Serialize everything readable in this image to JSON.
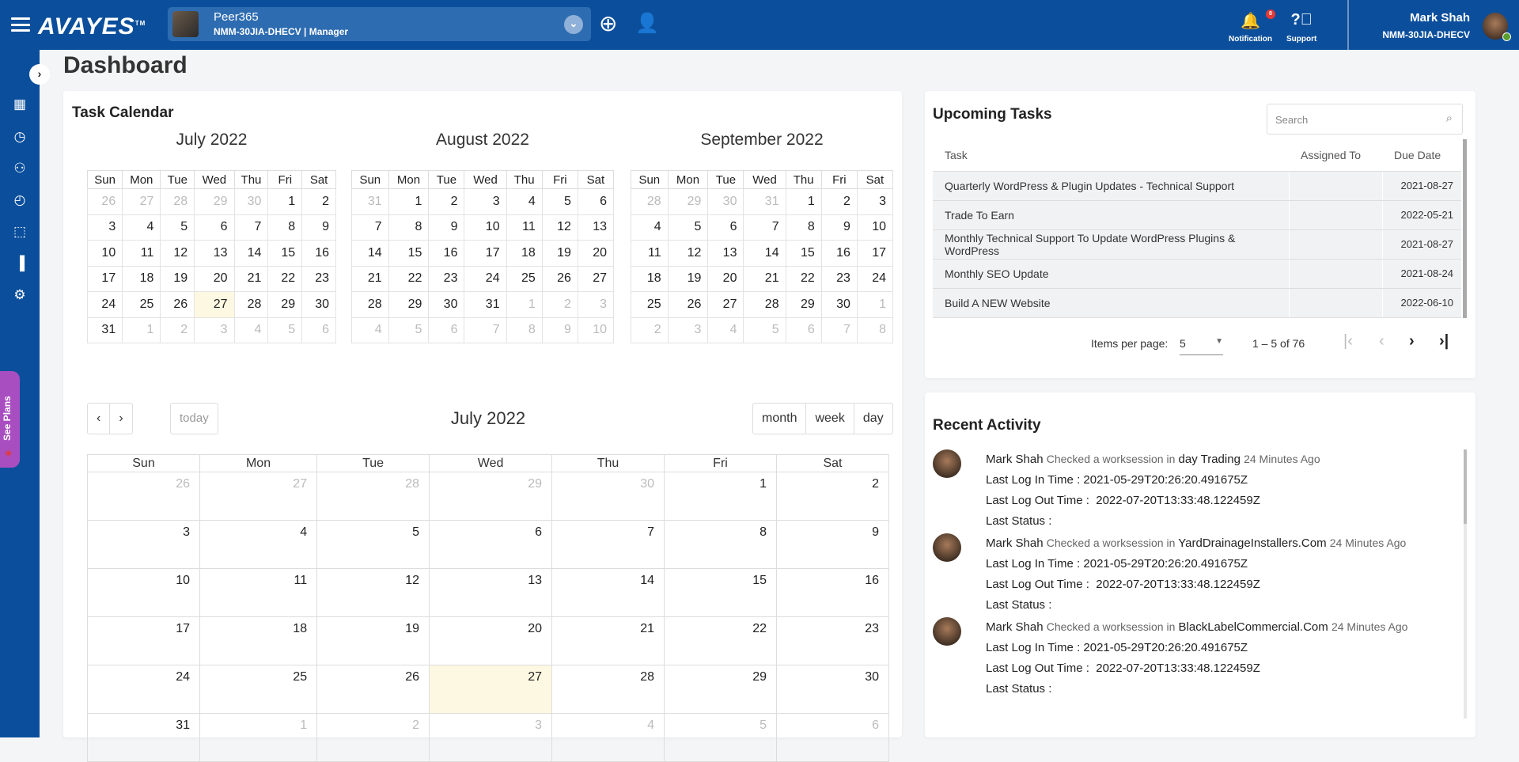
{
  "header": {
    "logo": "AVAYES",
    "logo_tm": "TM",
    "org_name": "Peer365",
    "org_sub": "NMM-30JIA-DHECV | Manager",
    "notification_label": "Notification",
    "notification_count": "8",
    "support_label": "Support",
    "user_name": "Mark Shah",
    "user_code": "NMM-30JIA-DHECV",
    "brand_color": "#0b4f9c"
  },
  "sidebar": {
    "items": [
      "dashboard-icon",
      "clock-icon",
      "users-icon",
      "time-add-icon",
      "selection-icon",
      "bar-chart-icon",
      "user-settings-icon"
    ],
    "see_plans": "See  Plans"
  },
  "page_title": "Dashboard",
  "task_calendar": {
    "title": "Task Calendar",
    "weekdays": [
      "Sun",
      "Mon",
      "Tue",
      "Wed",
      "Thu",
      "Fri",
      "Sat"
    ],
    "months": [
      {
        "title": "July 2022",
        "first": 26,
        "prev_len": 30,
        "len": 31,
        "rows": 6,
        "today": 27
      },
      {
        "title": "August 2022",
        "first": 31,
        "prev_len": 31,
        "len": 31,
        "rows": 6,
        "today": null
      },
      {
        "title": "September 2022",
        "first": 28,
        "prev_len": 31,
        "len": 30,
        "rows": 6,
        "today": null
      }
    ],
    "big": {
      "title": "July 2022",
      "today_label": "today",
      "views": [
        "month",
        "week",
        "day"
      ],
      "first": 26,
      "prev_len": 30,
      "len": 31,
      "rows": 6,
      "today": 27
    }
  },
  "upcoming": {
    "title": "Upcoming Tasks",
    "search_placeholder": "Search",
    "columns": [
      "Task",
      "Assigned To",
      "Due Date"
    ],
    "rows": [
      [
        "Quarterly WordPress & Plugin Updates - Technical Support",
        "",
        "2021-08-27"
      ],
      [
        "Trade To Earn",
        "",
        "2022-05-21"
      ],
      [
        "Monthly Technical Support To Update WordPress Plugins & WordPress",
        "",
        "2021-08-27"
      ],
      [
        "Monthly SEO Update",
        "",
        "2021-08-24"
      ],
      [
        "Build A NEW Website",
        "",
        "2022-06-10"
      ]
    ],
    "items_per_page_label": "Items per page:",
    "items_per_page": "5",
    "range": "1 – 5 of 76"
  },
  "activity": {
    "title": "Recent Activity",
    "items": [
      {
        "user": "Mark Shah",
        "action": "Checked a worksession in",
        "target": "day Trading",
        "ago": "24 Minutes Ago",
        "login": "Last Log In Time : 2021-05-29T20:26:20.491675Z",
        "logout": "Last Log Out Time :  2022-07-20T13:33:48.122459Z",
        "status": "Last Status :"
      },
      {
        "user": "Mark Shah",
        "action": "Checked a worksession in",
        "target": "YardDrainageInstallers.Com",
        "ago": "24 Minutes Ago",
        "login": "Last Log In Time : 2021-05-29T20:26:20.491675Z",
        "logout": "Last Log Out Time :  2022-07-20T13:33:48.122459Z",
        "status": "Last Status :"
      },
      {
        "user": "Mark Shah",
        "action": "Checked a worksession in",
        "target": "BlackLabelCommercial.Com",
        "ago": "24 Minutes Ago",
        "login": "Last Log In Time : 2021-05-29T20:26:20.491675Z",
        "logout": "Last Log Out Time :  2022-07-20T13:33:48.122459Z",
        "status": "Last Status :"
      }
    ]
  }
}
